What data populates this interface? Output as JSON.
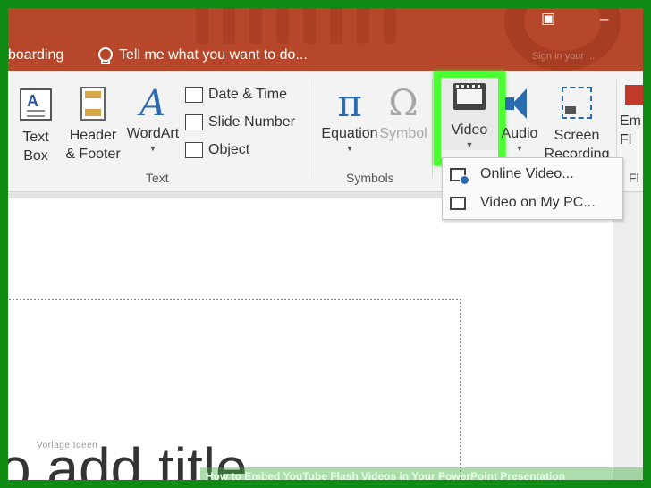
{
  "titlebar": {
    "tab_partial": "boarding",
    "tell_me": "Tell me what you want to do...",
    "user_partial": "Sign in your ...",
    "restore_icon": "ribbon-display-icon",
    "minimize_glyph": "–"
  },
  "ribbon": {
    "text_group": {
      "label": "Text",
      "text_box": [
        "Text",
        "Box"
      ],
      "header_footer": [
        "Header",
        "& Footer"
      ],
      "wordart": "WordArt",
      "wordart_glyph": "A",
      "date_time": "Date & Time",
      "slide_number": "Slide Number",
      "object": "Object"
    },
    "symbols_group": {
      "label": "Symbols",
      "equation": "Equation",
      "equation_glyph": "π",
      "symbol": "Symbol",
      "symbol_glyph": "Ω"
    },
    "media_group": {
      "label": "Fl",
      "video": "Video",
      "audio": "Audio",
      "screen_recording": [
        "Screen",
        "Recording"
      ],
      "embed_partial": [
        "Em",
        "Fl"
      ]
    }
  },
  "video_menu": {
    "items": [
      {
        "label": "Online Video...",
        "icon": "online-video-icon"
      },
      {
        "label": "Video on My PC...",
        "icon": "video-file-icon"
      }
    ]
  },
  "slide": {
    "title_placeholder": "o add title"
  },
  "overlay": {
    "watermark": "Vorlage Ideen",
    "caption": "How to Embed YouTube Flash Videos in Your PowerPoint Presentation"
  }
}
